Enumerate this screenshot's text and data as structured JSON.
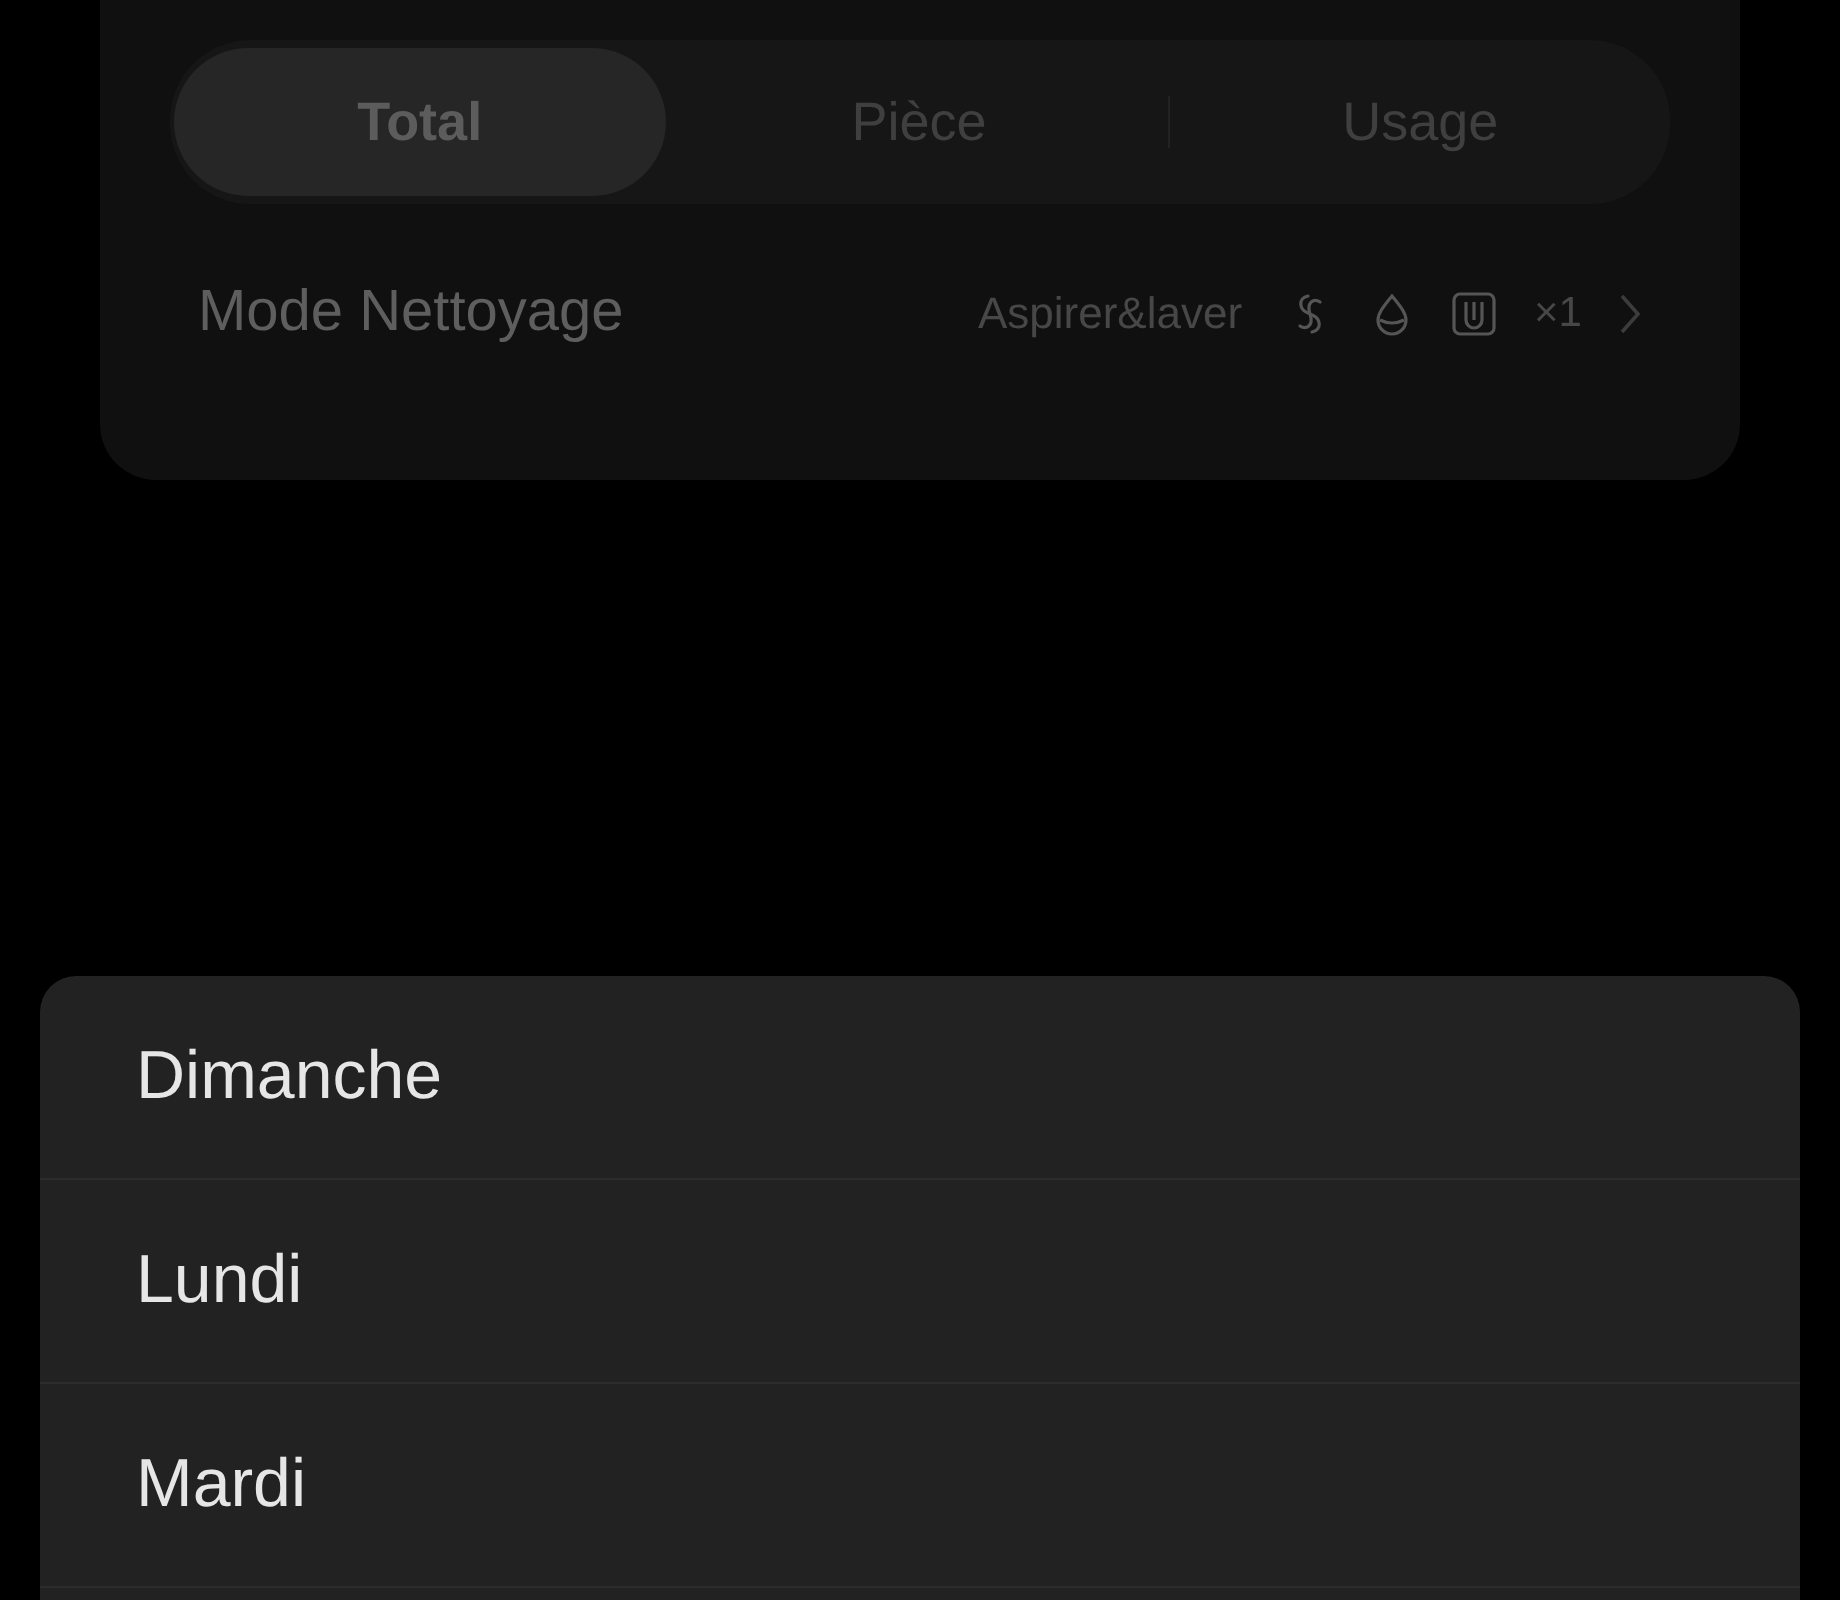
{
  "tabs": [
    {
      "label": "Total",
      "selected": true
    },
    {
      "label": "Pièce",
      "selected": false
    },
    {
      "label": "Usage",
      "selected": false
    }
  ],
  "cleaning_mode": {
    "label": "Mode Nettoyage",
    "value": "Aspirer&laver",
    "repeat": "×1"
  },
  "day_picker": {
    "items": [
      {
        "label": "Dimanche"
      },
      {
        "label": "Lundi"
      },
      {
        "label": "Mardi"
      }
    ]
  }
}
